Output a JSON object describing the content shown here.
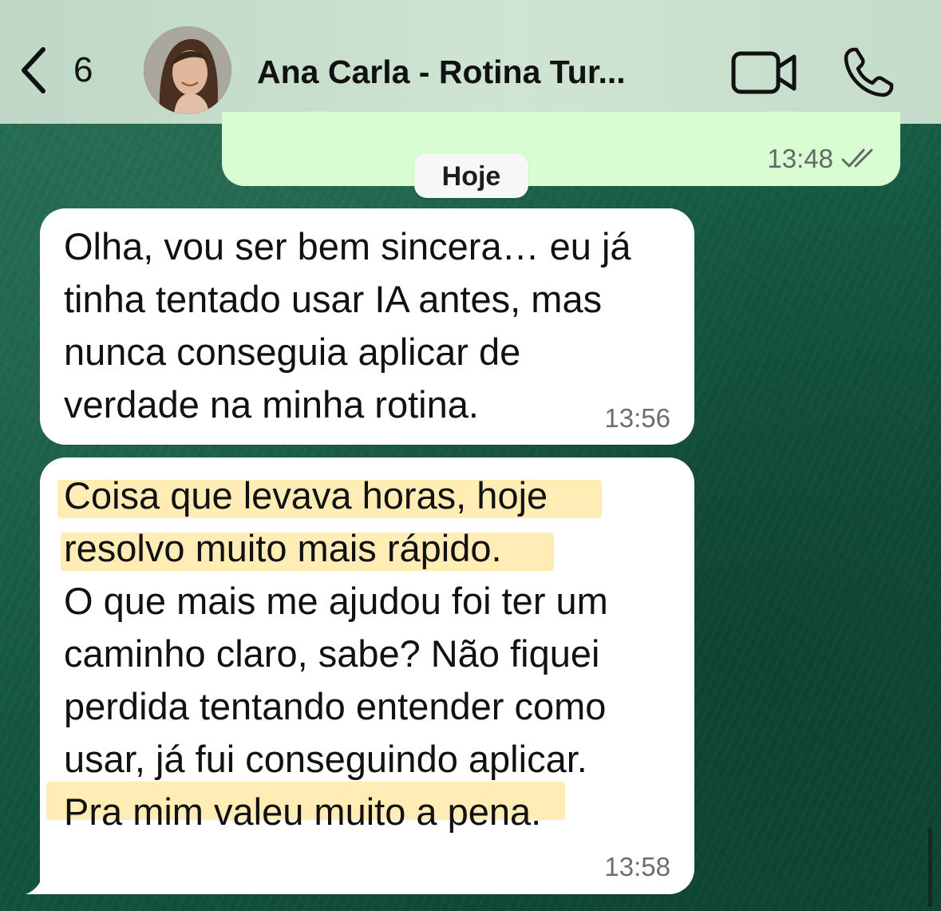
{
  "header": {
    "back_count": "6",
    "contact_name": "Ana Carla - Rotina Tur...",
    "icons": [
      "chevron-left-icon",
      "video-camera-icon",
      "phone-icon"
    ]
  },
  "top_message": {
    "time": "13:48",
    "status": "read"
  },
  "date_divider": "Hoje",
  "messages": [
    {
      "lines": [
        "Olha, vou ser bem sincera… eu já",
        "tinha tentado usar IA antes, mas",
        "nunca conseguia aplicar de",
        "verdade na minha rotina."
      ],
      "time": "13:56"
    },
    {
      "lines": [
        "Coisa que levava horas, hoje",
        "resolvo muito mais rápido.",
        "O que mais me ajudou foi ter um",
        "caminho claro, sabe? Não fiquei",
        "perdida tentando entender como",
        "usar, já fui conseguindo aplicar.",
        "Pra mim valeu muito a pena."
      ],
      "highlighted_lines": [
        0,
        1,
        6
      ],
      "time": "13:58"
    }
  ],
  "colors": {
    "incoming_bubble": "#ffffff",
    "outgoing_bubble": "#d9fdd3",
    "highlight": "#ffd75a",
    "header_bg": "#c9dfcd"
  }
}
